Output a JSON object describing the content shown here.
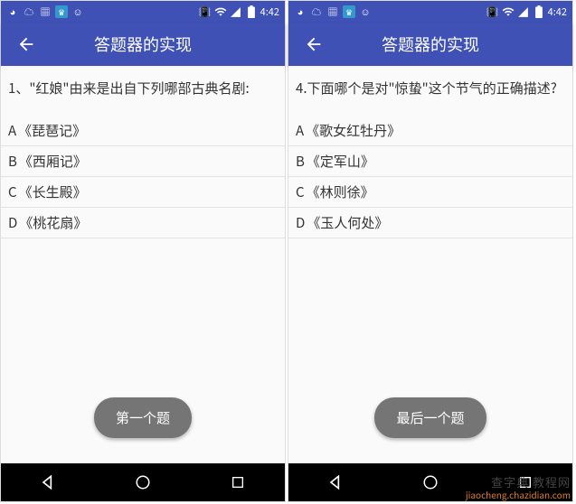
{
  "status_time": "4:42",
  "app_title": "答题器的实现",
  "screens": [
    {
      "question": "1、\"红娘\"由来是出自下列哪部古典名剧:",
      "options": [
        {
          "letter": "A",
          "text": "《琵琶记》"
        },
        {
          "letter": "B",
          "text": "《西厢记》"
        },
        {
          "letter": "C",
          "text": "《长生殿》"
        },
        {
          "letter": "D",
          "text": "《桃花扇》"
        }
      ],
      "button": "第一个题"
    },
    {
      "question": "4.下面哪个是对\"惊蛰\"这个节气的正确描述?",
      "options": [
        {
          "letter": "A",
          "text": "《歌女红牡丹》"
        },
        {
          "letter": "B",
          "text": "《定军山》"
        },
        {
          "letter": "C",
          "text": "《林则徐》"
        },
        {
          "letter": "D",
          "text": "《玉人何处》"
        }
      ],
      "button": "最后一个题"
    }
  ],
  "watermark": {
    "line1": "查字典 教程网",
    "line2": "jiaocheng.chazidian.com"
  }
}
